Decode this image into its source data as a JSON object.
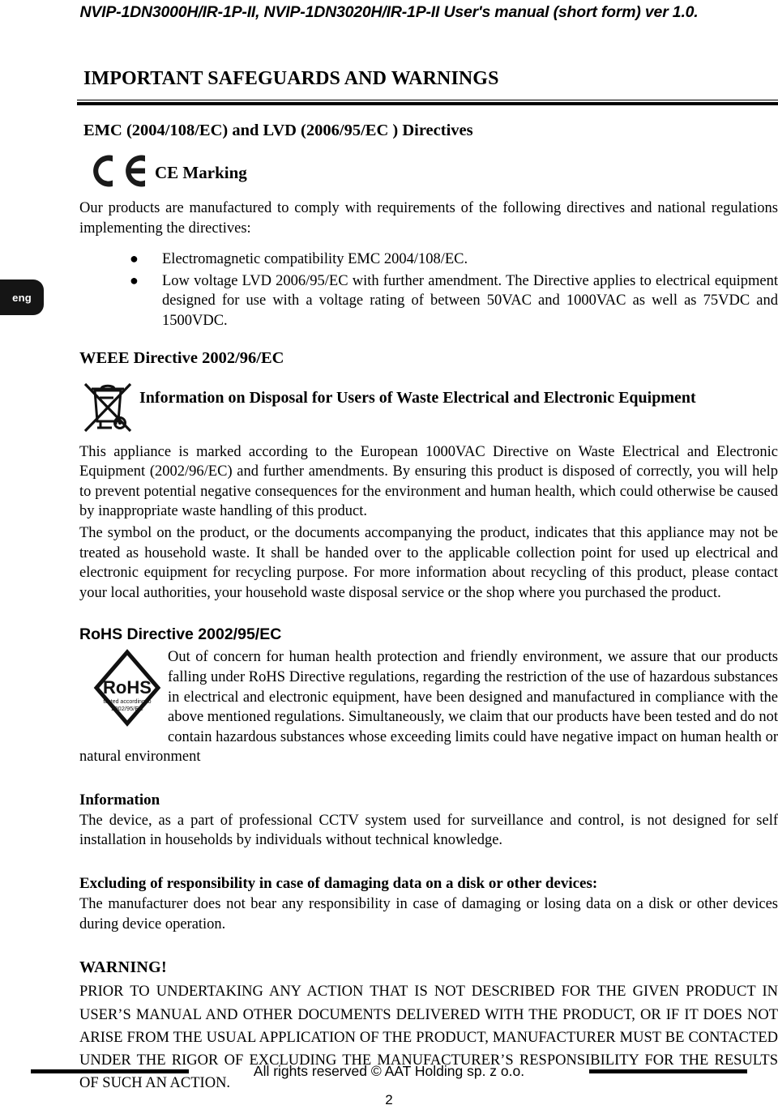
{
  "header": {
    "running_title": "NVIP-1DN3000H/IR-1P-II, NVIP-1DN3020H/IR-1P-II User's manual (short form) ver 1.0."
  },
  "language_tab": {
    "label": "eng"
  },
  "main": {
    "section_title": "IMPORTANT SAFEGUARDS AND WARNINGS",
    "emc_lvd": {
      "heading": "EMC (2004/108/EC) and LVD (2006/95/EC ) Directives",
      "ce_icon": "ce-marking-icon",
      "ce_label": "CE Marking",
      "intro": "Our products are manufactured to comply with requirements of the following directives and national regulations implementing the directives:",
      "bullets": [
        "Electromagnetic compatibility EMC 2004/108/EC.",
        "Low voltage LVD 2006/95/EC with further amendment. The Directive applies to electrical equipment designed for use with a voltage rating of between 50VAC and 1000VAC as well as 75VDC and 1500VDC."
      ]
    },
    "weee": {
      "heading": "WEEE Directive 2002/96/EC",
      "icon": "crossed-out-wheeled-bin-icon",
      "icon_label": "Information on Disposal for Users of Waste Electrical and Electronic Equipment",
      "paragraph_1": "This appliance is marked according to the European 1000VAC Directive on Waste Electrical and Electronic Equipment (2002/96/EC) and further amendments. By ensuring this product is disposed of correctly, you will help to prevent potential negative consequences for the environment and human health, which could otherwise be caused by inappropriate waste handling of this product.",
      "paragraph_2": "The symbol on the product, or the documents accompanying the product, indicates that this appliance may not be treated as household waste. It shall be handed over to the applicable collection point for used up electrical and electronic equipment for recycling purpose. For more information about recycling of this product, please contact your local authorities, your household waste disposal service or the shop where you purchased the product."
    },
    "rohs": {
      "heading": "RoHS Directive 2002/95/EC",
      "icon": "rohs-logo-icon",
      "logo_text": "RoHS",
      "logo_sub_line_1": "tested according to",
      "logo_sub_line_2": "2002/95/EC",
      "paragraph": "Out of concern for human health protection and friendly environment, we assure that our products falling under RoHS Directive regulations, regarding the restriction of the use of hazardous substances in electrical and electronic equipment, have been designed and manufactured in compliance with the above mentioned regulations. Simultaneously, we claim that our products have been tested and do not contain hazardous substances whose exceeding limits could have negative impact on human health or natural environment"
    },
    "information": {
      "heading": "Information",
      "paragraph": "The device, as a part of professional CCTV system used for surveillance and control, is not designed for self installation in households by individuals without technical knowledge."
    },
    "excluding": {
      "heading": "Excluding of responsibility in case of damaging data on a disk or other devices:",
      "paragraph": "The manufacturer does not bear any responsibility in case of damaging or losing data on a disk or other devices during device operation."
    },
    "warning": {
      "heading": "WARNING!",
      "paragraph": "PRIOR TO UNDERTAKING ANY ACTION THAT IS NOT DESCRIBED FOR THE GIVEN PRODUCT IN USER’S MANUAL AND OTHER DOCUMENTS DELIVERED WITH THE PRODUCT, OR IF IT DOES NOT ARISE FROM THE USUAL APPLICATION OF THE PRODUCT,  MANUFACTURER MUST BE CONTACTED UNDER THE RIGOR OF EXCLUDING THE MANUFACTURER’S  RESPONSIBILITY FOR THE RESULTS OF SUCH AN ACTION."
    }
  },
  "footer": {
    "copyright": "All rights reserved © AAT Holding sp. z o.o.",
    "page_number": "2"
  },
  "colors": {
    "text": "#000000",
    "background": "#ffffff",
    "tab_background": "#151515",
    "tab_text": "#ffffff"
  }
}
